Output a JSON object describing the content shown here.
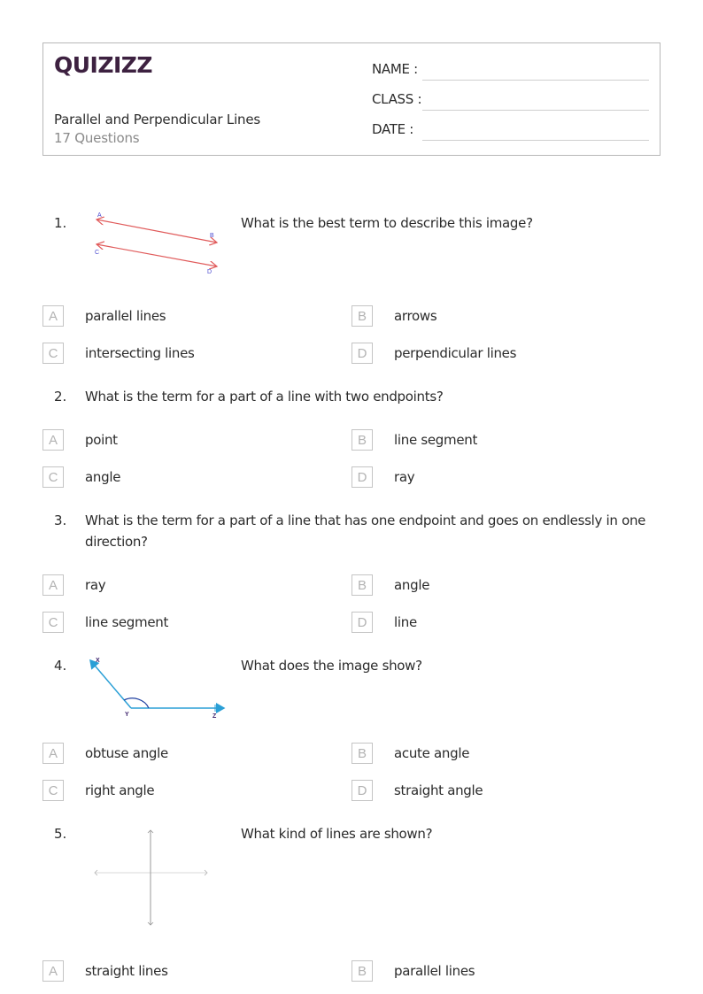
{
  "header": {
    "logo": "QUIZIZZ",
    "worksheet_title": "Parallel and Perpendicular Lines",
    "question_count": "17 Questions",
    "fields": [
      {
        "label": "NAME :"
      },
      {
        "label": "CLASS :"
      },
      {
        "label": "DATE  :"
      }
    ]
  },
  "questions": [
    {
      "number": "1.",
      "text": "What is the best term to describe this image?",
      "figure": {
        "type": "parallel-lines",
        "labels": [
          "A",
          "B",
          "C",
          "D"
        ],
        "color": "#e05a5a",
        "label_color": "#4a4ad0"
      },
      "options": [
        {
          "letter": "A",
          "text": "parallel lines"
        },
        {
          "letter": "B",
          "text": "arrows"
        },
        {
          "letter": "C",
          "text": "intersecting lines"
        },
        {
          "letter": "D",
          "text": "perpendicular lines"
        }
      ]
    },
    {
      "number": "2.",
      "text": "What is the term for a part of a line with two endpoints?",
      "options": [
        {
          "letter": "A",
          "text": "point"
        },
        {
          "letter": "B",
          "text": "line segment"
        },
        {
          "letter": "C",
          "text": "angle"
        },
        {
          "letter": "D",
          "text": "ray"
        }
      ]
    },
    {
      "number": "3.",
      "text_line1": "What is the term for a part of a line that has one endpoint and goes on endlessly in one",
      "text_line2": "direction?",
      "options": [
        {
          "letter": "A",
          "text": "ray"
        },
        {
          "letter": "B",
          "text": "angle"
        },
        {
          "letter": "C",
          "text": "line segment"
        },
        {
          "letter": "D",
          "text": "line"
        }
      ]
    },
    {
      "number": "4.",
      "text": "What does the image show?",
      "figure": {
        "type": "obtuse-angle",
        "labels": [
          "X",
          "Y",
          "Z"
        ],
        "color": "#2a9fd6",
        "arc_color": "#1f3fa0",
        "label_color": "#3a1f6a"
      },
      "options": [
        {
          "letter": "A",
          "text": "obtuse angle"
        },
        {
          "letter": "B",
          "text": "acute angle"
        },
        {
          "letter": "C",
          "text": "right angle"
        },
        {
          "letter": "D",
          "text": "straight angle"
        }
      ]
    },
    {
      "number": "5.",
      "text": "What kind of lines are shown?",
      "figure": {
        "type": "perpendicular-lines",
        "color": "#9a9a9a"
      },
      "options": [
        {
          "letter": "A",
          "text": "straight lines"
        },
        {
          "letter": "B",
          "text": "parallel lines"
        }
      ]
    }
  ]
}
